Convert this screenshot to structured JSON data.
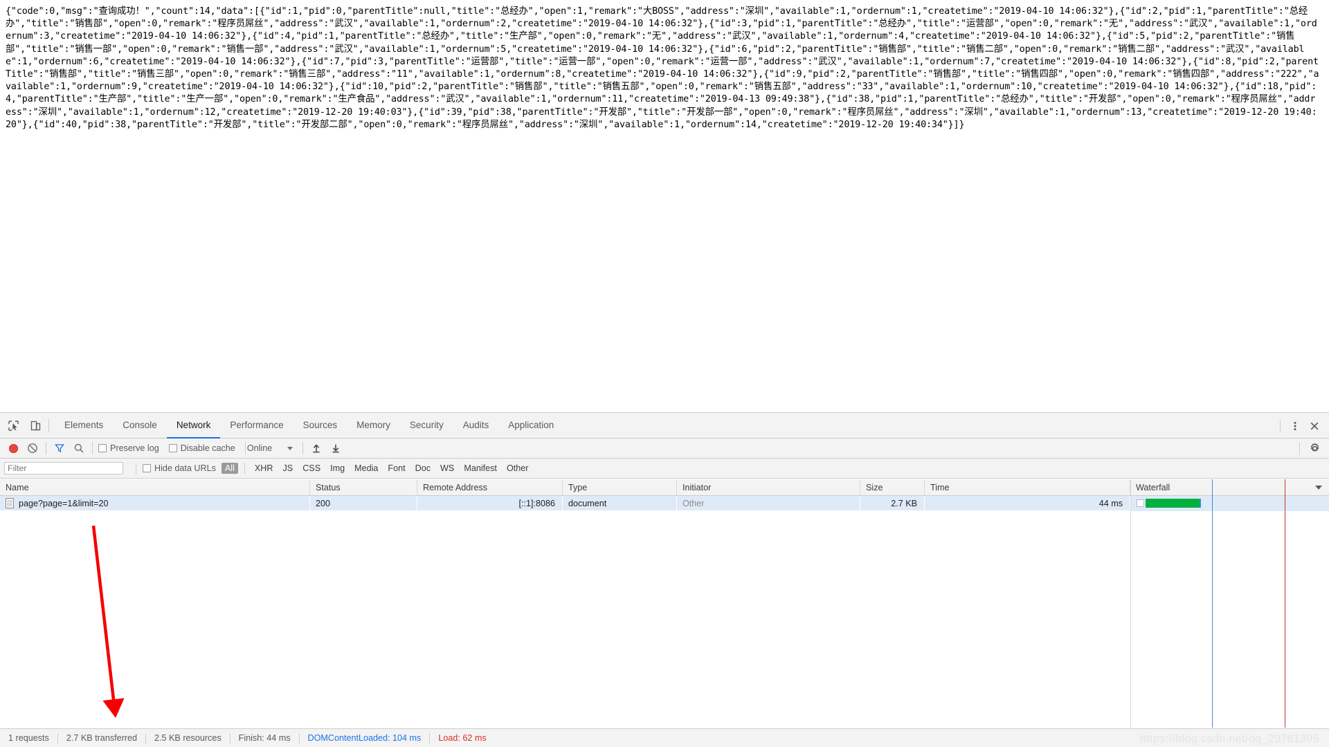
{
  "page": {
    "response_json": "{\"code\":0,\"msg\":\"查询成功！\",\"count\":14,\"data\":[{\"id\":1,\"pid\":0,\"parentTitle\":null,\"title\":\"总经办\",\"open\":1,\"remark\":\"大BOSS\",\"address\":\"深圳\",\"available\":1,\"ordernum\":1,\"createtime\":\"2019-04-10 14:06:32\"},{\"id\":2,\"pid\":1,\"parentTitle\":\"总经办\",\"title\":\"销售部\",\"open\":0,\"remark\":\"程序员屌丝\",\"address\":\"武汉\",\"available\":1,\"ordernum\":2,\"createtime\":\"2019-04-10 14:06:32\"},{\"id\":3,\"pid\":1,\"parentTitle\":\"总经办\",\"title\":\"运营部\",\"open\":0,\"remark\":\"无\",\"address\":\"武汉\",\"available\":1,\"ordernum\":3,\"createtime\":\"2019-04-10 14:06:32\"},{\"id\":4,\"pid\":1,\"parentTitle\":\"总经办\",\"title\":\"生产部\",\"open\":0,\"remark\":\"无\",\"address\":\"武汉\",\"available\":1,\"ordernum\":4,\"createtime\":\"2019-04-10 14:06:32\"},{\"id\":5,\"pid\":2,\"parentTitle\":\"销售部\",\"title\":\"销售一部\",\"open\":0,\"remark\":\"销售一部\",\"address\":\"武汉\",\"available\":1,\"ordernum\":5,\"createtime\":\"2019-04-10 14:06:32\"},{\"id\":6,\"pid\":2,\"parentTitle\":\"销售部\",\"title\":\"销售二部\",\"open\":0,\"remark\":\"销售二部\",\"address\":\"武汉\",\"available\":1,\"ordernum\":6,\"createtime\":\"2019-04-10 14:06:32\"},{\"id\":7,\"pid\":3,\"parentTitle\":\"运营部\",\"title\":\"运营一部\",\"open\":0,\"remark\":\"运营一部\",\"address\":\"武汉\",\"available\":1,\"ordernum\":7,\"createtime\":\"2019-04-10 14:06:32\"},{\"id\":8,\"pid\":2,\"parentTitle\":\"销售部\",\"title\":\"销售三部\",\"open\":0,\"remark\":\"销售三部\",\"address\":\"11\",\"available\":1,\"ordernum\":8,\"createtime\":\"2019-04-10 14:06:32\"},{\"id\":9,\"pid\":2,\"parentTitle\":\"销售部\",\"title\":\"销售四部\",\"open\":0,\"remark\":\"销售四部\",\"address\":\"222\",\"available\":1,\"ordernum\":9,\"createtime\":\"2019-04-10 14:06:32\"},{\"id\":10,\"pid\":2,\"parentTitle\":\"销售部\",\"title\":\"销售五部\",\"open\":0,\"remark\":\"销售五部\",\"address\":\"33\",\"available\":1,\"ordernum\":10,\"createtime\":\"2019-04-10 14:06:32\"},{\"id\":18,\"pid\":4,\"parentTitle\":\"生产部\",\"title\":\"生产一部\",\"open\":0,\"remark\":\"生产食品\",\"address\":\"武汉\",\"available\":1,\"ordernum\":11,\"createtime\":\"2019-04-13 09:49:38\"},{\"id\":38,\"pid\":1,\"parentTitle\":\"总经办\",\"title\":\"开发部\",\"open\":0,\"remark\":\"程序员屌丝\",\"address\":\"深圳\",\"available\":1,\"ordernum\":12,\"createtime\":\"2019-12-20 19:40:03\"},{\"id\":39,\"pid\":38,\"parentTitle\":\"开发部\",\"title\":\"开发部一部\",\"open\":0,\"remark\":\"程序员屌丝\",\"address\":\"深圳\",\"available\":1,\"ordernum\":13,\"createtime\":\"2019-12-20 19:40:20\"},{\"id\":40,\"pid\":38,\"parentTitle\":\"开发部\",\"title\":\"开发部二部\",\"open\":0,\"remark\":\"程序员屌丝\",\"address\":\"深圳\",\"available\":1,\"ordernum\":14,\"createtime\":\"2019-12-20 19:40:34\"}]}"
  },
  "devtools": {
    "tabs": [
      {
        "label": "Elements",
        "selected": false
      },
      {
        "label": "Console",
        "selected": false
      },
      {
        "label": "Network",
        "selected": true
      },
      {
        "label": "Performance",
        "selected": false
      },
      {
        "label": "Sources",
        "selected": false
      },
      {
        "label": "Memory",
        "selected": false
      },
      {
        "label": "Security",
        "selected": false
      },
      {
        "label": "Audits",
        "selected": false
      },
      {
        "label": "Application",
        "selected": false
      }
    ],
    "toolbar": {
      "record_icon": "record-circle-icon",
      "clear_icon": "clear-prohibited-icon",
      "filter_icon": "funnel-filter-icon",
      "search_icon": "magnifier-search-icon",
      "preserve_log_label": "Preserve log",
      "preserve_log_checked": false,
      "disable_cache_label": "Disable cache",
      "disable_cache_checked": false,
      "throttle_value": "Online",
      "import_icon": "upload-arrow-icon",
      "export_icon": "download-arrow-icon",
      "settings_icon": "gear-icon",
      "more_icon": "kebab-menu-icon",
      "close_icon": "close-x-icon",
      "inspect_icon": "inspect-cursor-icon",
      "device_icon": "device-toggle-icon"
    },
    "filterbar": {
      "filter_placeholder": "Filter",
      "filter_value": "",
      "hide_data_urls_label": "Hide data URLs",
      "hide_data_urls_checked": false,
      "types": [
        {
          "label": "All",
          "active": true
        },
        {
          "label": "XHR",
          "active": false
        },
        {
          "label": "JS",
          "active": false
        },
        {
          "label": "CSS",
          "active": false
        },
        {
          "label": "Img",
          "active": false
        },
        {
          "label": "Media",
          "active": false
        },
        {
          "label": "Font",
          "active": false
        },
        {
          "label": "Doc",
          "active": false
        },
        {
          "label": "WS",
          "active": false
        },
        {
          "label": "Manifest",
          "active": false
        },
        {
          "label": "Other",
          "active": false
        }
      ]
    },
    "table": {
      "columns": [
        "Name",
        "Status",
        "Remote Address",
        "Type",
        "Initiator",
        "Size",
        "Time",
        "Waterfall"
      ],
      "rows": [
        {
          "name": "page?page=1&limit=20",
          "status": "200",
          "remote_address": "[::1]:8086",
          "type": "document",
          "initiator": "Other",
          "size": "2.7 KB",
          "time": "44 ms"
        }
      ]
    },
    "status": {
      "requests": "1 requests",
      "transferred": "2.7 KB transferred",
      "resources": "2.5 KB resources",
      "finish": "Finish: 44 ms",
      "dom_content_loaded": "DOMContentLoaded: 104 ms",
      "load": "Load: 62 ms"
    }
  },
  "annotation": {
    "arrow_color": "#f50000",
    "arrow_name": "red-pointer-arrow"
  },
  "watermark": {
    "text": "https://blog.csdn.net/qq_29761395"
  },
  "colors": {
    "accent": "#1a73e8",
    "waterfall_bar": "#00b140",
    "load_red": "#d93025",
    "row_selected": "#dfeaf8"
  }
}
